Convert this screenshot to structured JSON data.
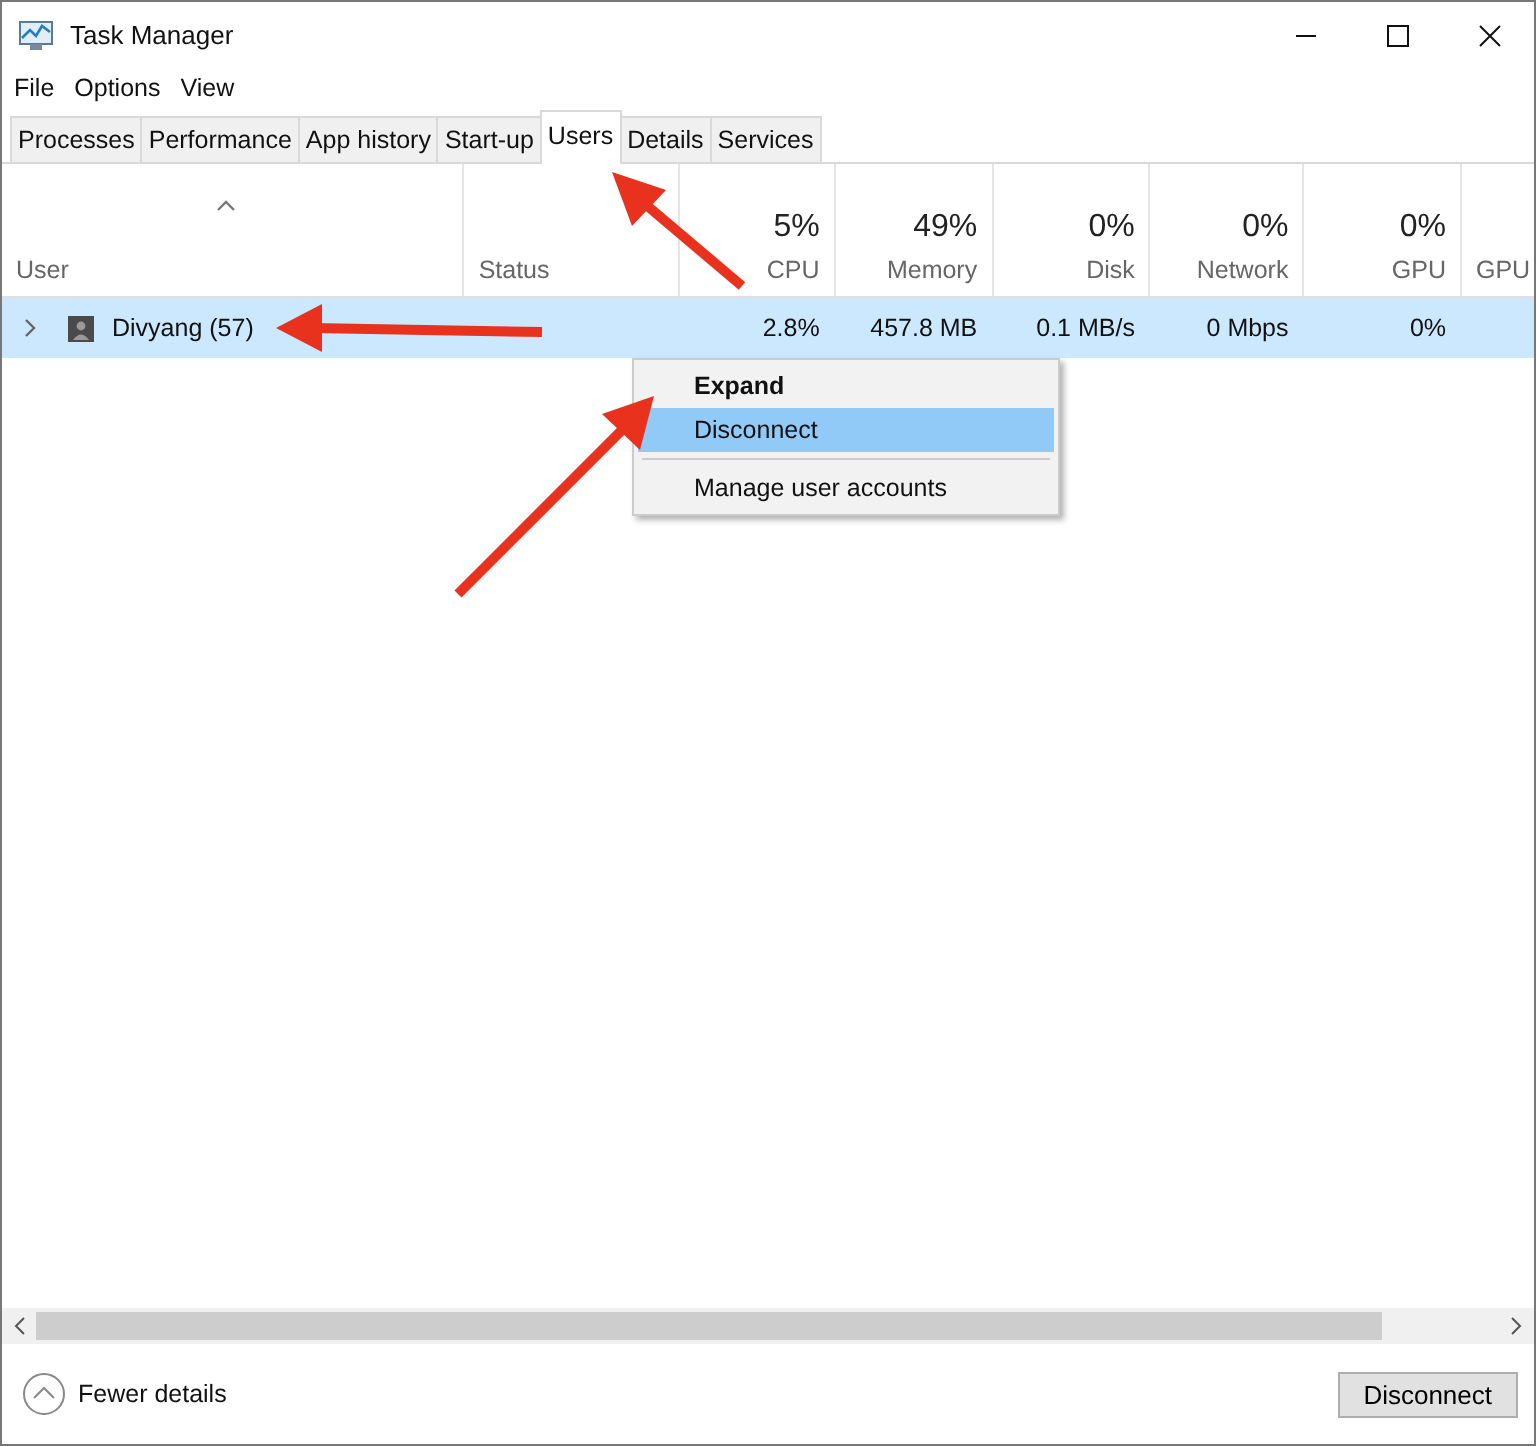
{
  "window": {
    "title": "Task Manager"
  },
  "menu": [
    "File",
    "Options",
    "View"
  ],
  "tabs": [
    {
      "label": "Processes",
      "selected": false
    },
    {
      "label": "Performance",
      "selected": false
    },
    {
      "label": "App history",
      "selected": false
    },
    {
      "label": "Start-up",
      "selected": false
    },
    {
      "label": "Users",
      "selected": true
    },
    {
      "label": "Details",
      "selected": false
    },
    {
      "label": "Services",
      "selected": false
    }
  ],
  "table": {
    "columns": [
      {
        "label": "User",
        "sorted": true
      },
      {
        "label": "Status",
        "sorted": false
      },
      {
        "label": "CPU",
        "percent": "5%",
        "sorted": false
      },
      {
        "label": "Memory",
        "percent": "49%",
        "sorted": false
      },
      {
        "label": "Disk",
        "percent": "0%",
        "sorted": false
      },
      {
        "label": "Network",
        "percent": "0%",
        "sorted": false
      },
      {
        "label": "GPU",
        "percent": "0%",
        "sorted": false
      },
      {
        "label": "GPU",
        "sorted": false
      }
    ],
    "rows": [
      {
        "expanded": false,
        "selected": true,
        "cells": [
          "Divyang (57)",
          "",
          "2.8%",
          "457.8 MB",
          "0.1 MB/s",
          "0 Mbps",
          "0%",
          ""
        ]
      }
    ]
  },
  "context_menu": [
    {
      "kind": "item",
      "label": "Expand",
      "default": true,
      "selected": false
    },
    {
      "kind": "item",
      "label": "Disconnect",
      "default": false,
      "selected": true
    },
    {
      "kind": "separator"
    },
    {
      "kind": "item",
      "label": "Manage user accounts",
      "default": false,
      "selected": false
    }
  ],
  "footer": {
    "toggle": "Fewer details",
    "button": "Disconnect"
  }
}
